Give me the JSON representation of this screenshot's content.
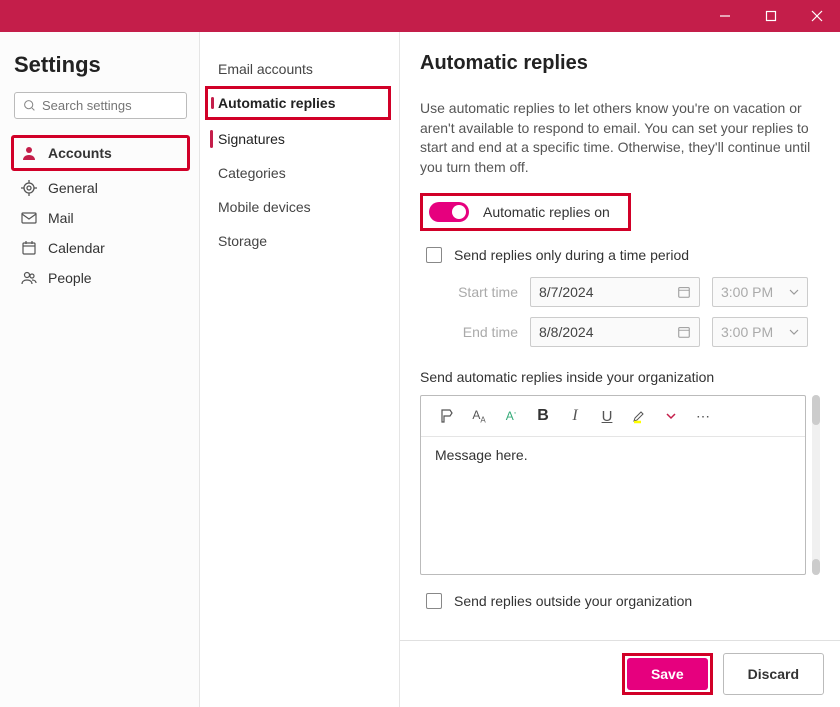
{
  "titlebar": {
    "minimize": "—",
    "maximize": "☐",
    "close": "✕"
  },
  "sidebar": {
    "title": "Settings",
    "search_placeholder": "Search settings",
    "items": [
      {
        "label": "Accounts",
        "active": true
      },
      {
        "label": "General"
      },
      {
        "label": "Mail"
      },
      {
        "label": "Calendar"
      },
      {
        "label": "People"
      }
    ]
  },
  "subsidebar": {
    "items": [
      {
        "label": "Email accounts"
      },
      {
        "label": "Automatic replies",
        "active": true
      },
      {
        "label": "Signatures"
      },
      {
        "label": "Categories"
      },
      {
        "label": "Mobile devices"
      },
      {
        "label": "Storage"
      }
    ]
  },
  "main": {
    "title": "Automatic replies",
    "description": "Use automatic replies to let others know you're on vacation or aren't available to respond to email. You can set your replies to start and end at a specific time. Otherwise, they'll continue until you turn them off.",
    "toggle_label": "Automatic replies on",
    "time_period_label": "Send replies only during a time period",
    "start_label": "Start time",
    "end_label": "End time",
    "start_date": "8/7/2024",
    "start_time": "3:00 PM",
    "end_date": "8/8/2024",
    "end_time": "3:00 PM",
    "inside_label": "Send automatic replies inside your organization",
    "message_placeholder": "Message here.",
    "outside_label": "Send replies outside your organization",
    "save_label": "Save",
    "discard_label": "Discard"
  },
  "colors": {
    "accent": "#c41e4a",
    "magenta": "#e6007e",
    "highlight_border": "#d10028"
  }
}
